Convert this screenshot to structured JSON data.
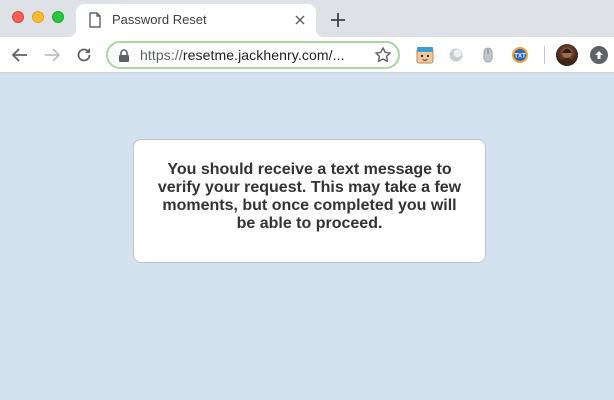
{
  "browser": {
    "tab": {
      "title": "Password Reset",
      "favicon": "document-icon"
    },
    "toolbar": {
      "url_scheme": "https://",
      "url_host": "resetme.jackhenry.com/...",
      "extensions": [
        "note-face-icon",
        "circle-extension-icon",
        "mouse-extension-icon",
        "txt-extension-icon"
      ],
      "ext_txt_label": "TXT"
    },
    "colors": {
      "omnibox_focus": "#a8d7a0",
      "page_background": "#d4e2ef"
    }
  },
  "page": {
    "message": "You should receive a text message to verify your request. This may take a few moments, but once completed you will be able to proceed."
  }
}
